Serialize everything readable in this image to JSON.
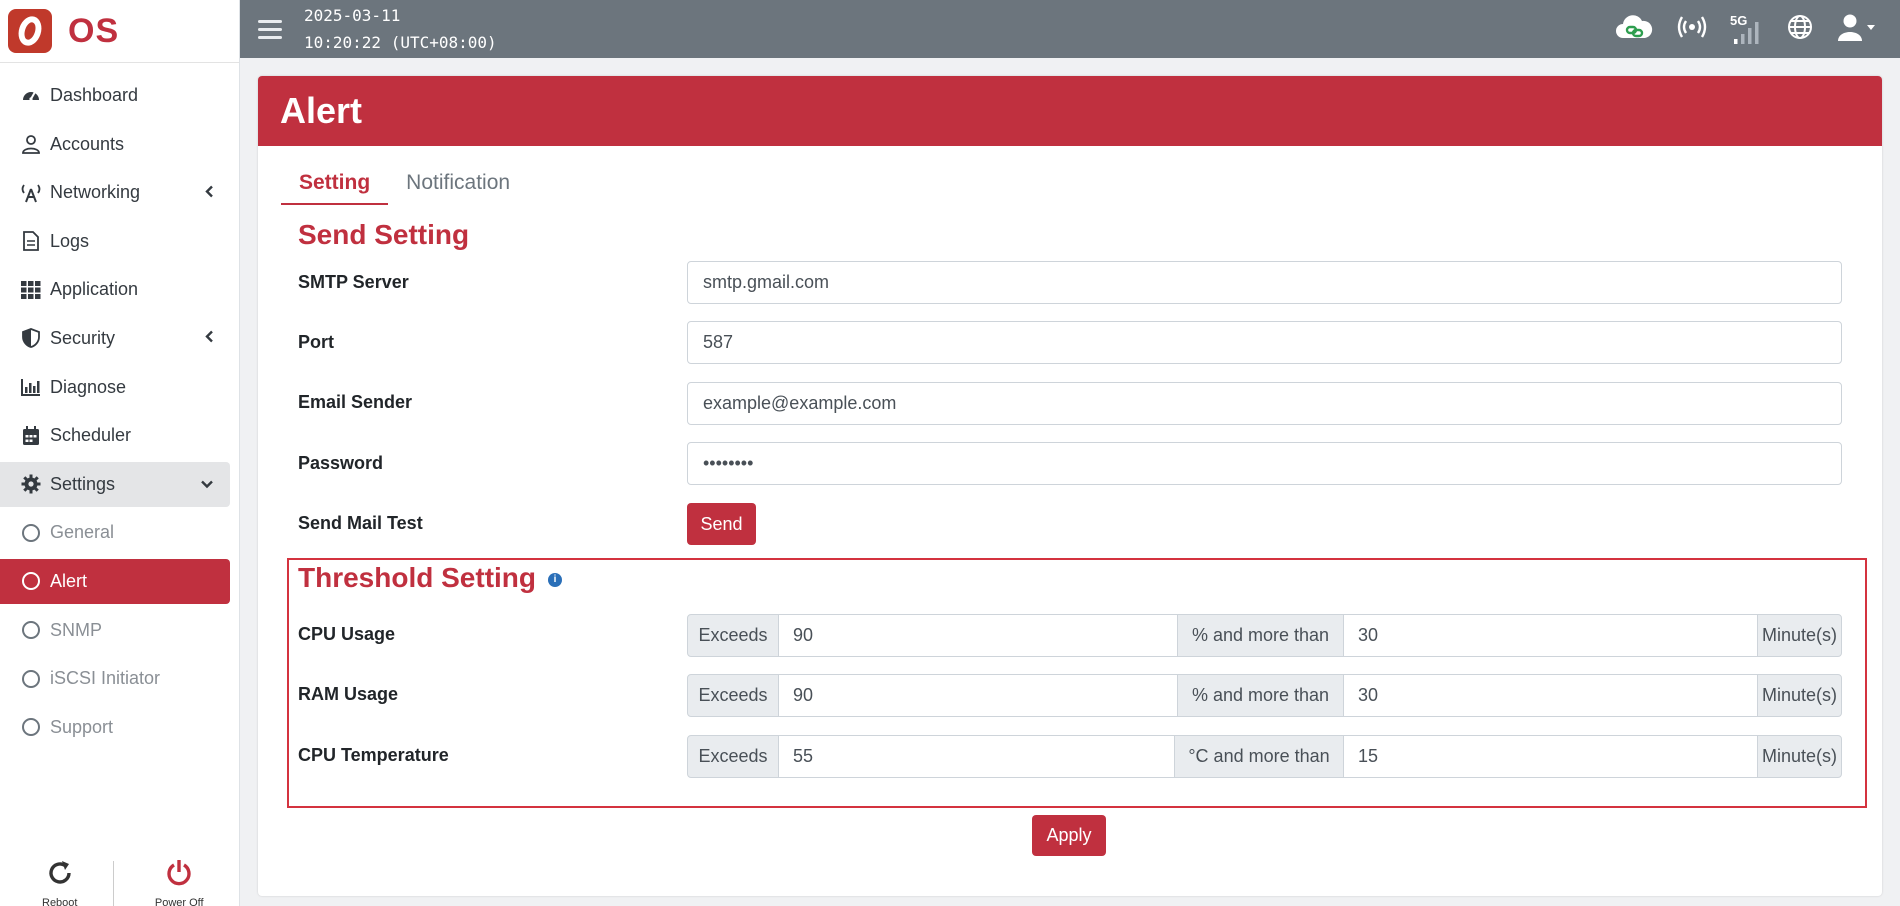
{
  "brand": {
    "name": "OS",
    "color": "#c0303f"
  },
  "topbar": {
    "date": "2025-03-11",
    "time": "10:20:22 (UTC+08:00)",
    "network": "5G"
  },
  "sidebar": {
    "items": [
      {
        "label": "Dashboard",
        "icon": "tachometer-icon"
      },
      {
        "label": "Accounts",
        "icon": "user-icon"
      },
      {
        "label": "Networking",
        "icon": "antenna-icon"
      },
      {
        "label": "Logs",
        "icon": "file-icon"
      },
      {
        "label": "Application",
        "icon": "grid-icon"
      },
      {
        "label": "Security",
        "icon": "shield-icon"
      },
      {
        "label": "Diagnose",
        "icon": "chart-icon"
      },
      {
        "label": "Scheduler",
        "icon": "calendar-icon"
      },
      {
        "label": "Settings",
        "icon": "gear-icon"
      }
    ],
    "sub_items": [
      {
        "label": "General"
      },
      {
        "label": "Alert"
      },
      {
        "label": "SNMP"
      },
      {
        "label": "iSCSI Initiator"
      },
      {
        "label": "Support"
      }
    ],
    "footer": {
      "reboot": "Reboot",
      "power_off": "Power Off"
    }
  },
  "page": {
    "title": "Alert",
    "tabs": [
      "Setting",
      "Notification"
    ],
    "send_setting": {
      "title": "Send Setting",
      "smtp_label": "SMTP Server",
      "smtp_value": "smtp.gmail.com",
      "port_label": "Port",
      "port_value": "587",
      "sender_label": "Email Sender",
      "sender_value": "example@example.com",
      "password_label": "Password",
      "password_value": "••••••••",
      "test_label": "Send Mail Test",
      "send_button": "Send"
    },
    "threshold": {
      "title": "Threshold Setting",
      "rows": [
        {
          "label": "CPU Usage",
          "prefix": "Exceeds",
          "value": "90",
          "middle": "% and more than",
          "duration": "30",
          "unit": "Minute(s)"
        },
        {
          "label": "RAM Usage",
          "prefix": "Exceeds",
          "value": "90",
          "middle": "% and more than",
          "duration": "30",
          "unit": "Minute(s)"
        },
        {
          "label": "CPU Temperature",
          "prefix": "Exceeds",
          "value": "55",
          "middle": "°C and more than",
          "duration": "15",
          "unit": "Minute(s)"
        }
      ]
    },
    "apply_button": "Apply"
  }
}
